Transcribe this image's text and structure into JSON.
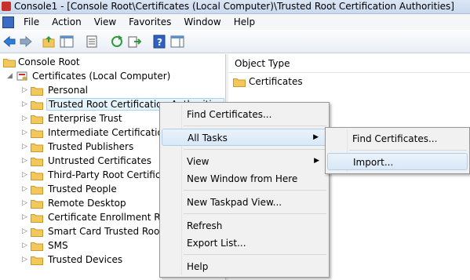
{
  "window": {
    "title": "Console1 - [Console Root\\Certificates (Local Computer)\\Trusted Root Certification Authorities]"
  },
  "menu": [
    "File",
    "Action",
    "View",
    "Favorites",
    "Window",
    "Help"
  ],
  "toolbar": [
    "back-icon",
    "forward-icon",
    "up-folder-icon",
    "show-hide-tree-icon",
    "properties-icon",
    "refresh-icon",
    "export-list-icon",
    "help-icon",
    "show-hide-action-pane-icon"
  ],
  "tree": {
    "root": "Console Root",
    "certs": "Certificates (Local Computer)",
    "items": [
      "Personal",
      "Trusted Root Certification Authorities",
      "Enterprise Trust",
      "Intermediate Certification Authorities",
      "Trusted Publishers",
      "Untrusted Certificates",
      "Third-Party Root Certification Authorities",
      "Trusted People",
      "Remote Desktop",
      "Certificate Enrollment Requests",
      "Smart Card Trusted Roots",
      "SMS",
      "Trusted Devices"
    ]
  },
  "right_pane": {
    "column": "Object Type",
    "rows": [
      "Certificates"
    ]
  },
  "context_menu": {
    "find": "Find Certificates...",
    "all_tasks": "All Tasks",
    "view": "View",
    "new_window": "New Window from Here",
    "new_taskpad": "New Taskpad View...",
    "refresh": "Refresh",
    "export": "Export List...",
    "help": "Help"
  },
  "submenu": {
    "find": "Find Certificates...",
    "import": "Import..."
  },
  "colors": {
    "folder": "#f2c75c",
    "highlight": "#d9e8f7",
    "menu_bg": "#f1f1f1"
  }
}
